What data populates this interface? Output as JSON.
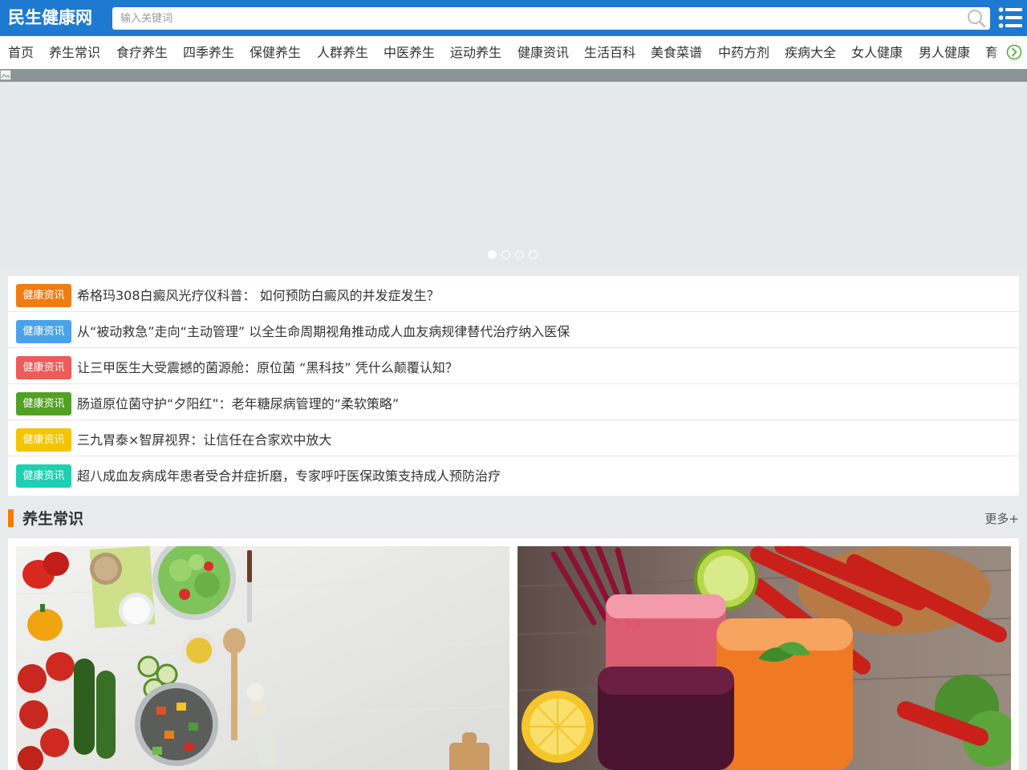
{
  "header": {
    "logo": "民生健康网",
    "search_placeholder": "输入关键词",
    "brand_color": "#1e7ad0"
  },
  "nav": {
    "items": [
      "首页",
      "养生常识",
      "食疗养生",
      "四季养生",
      "保健养生",
      "人群养生",
      "中医养生",
      "运动养生",
      "健康资讯",
      "生活百科",
      "美食菜谱",
      "中药方剂",
      "疾病大全",
      "女人健康",
      "男人健康",
      "育"
    ]
  },
  "banner": {
    "slide_count": 4,
    "active_slide": 1
  },
  "news": {
    "items": [
      {
        "tag": "健康资讯",
        "tag_color": "#f07d12",
        "title": "希格玛308白癜风光疗仪科普： 如何预防白癜风的并发症发生？"
      },
      {
        "tag": "健康资讯",
        "tag_color": "#4aa3ea",
        "title": "从“被动救急”走向“主动管理” 以全生命周期视角推动成人血友病规律替代治疗纳入医保"
      },
      {
        "tag": "健康资讯",
        "tag_color": "#ef5a5a",
        "title": "让三甲医生大受震撼的菌源舱：原位菌 “黑科技” 凭什么颠覆认知？"
      },
      {
        "tag": "健康资讯",
        "tag_color": "#52a125",
        "title": "肠道原位菌守护“夕阳红”：老年糖尿病管理的“柔软策略”"
      },
      {
        "tag": "健康资讯",
        "tag_color": "#f5c400",
        "title": "三九胃泰×智屏视界：让信任在合家欢中放大"
      },
      {
        "tag": "健康资讯",
        "tag_color": "#1fcfb1",
        "title": "超八成血友病成年患者受合并症折磨，专家呼吁医保政策支持成人预防治疗"
      }
    ]
  },
  "section": {
    "title": "养生常识",
    "more": "更多+",
    "accent_color": "#f57c00"
  },
  "icons": [
    "search-icon",
    "menu-icon",
    "chevron-right-icon",
    "broken-image-icon"
  ]
}
